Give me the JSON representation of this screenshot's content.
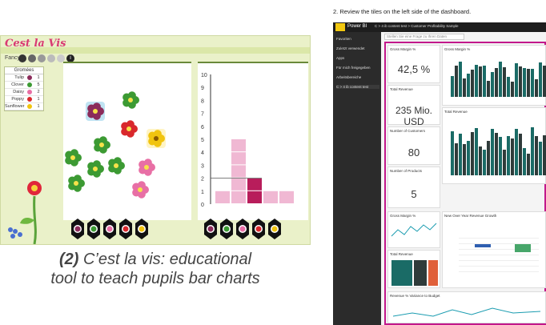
{
  "left": {
    "logo": "Cest la Vis",
    "selector_label": "Fancy",
    "circle_colors": [
      "#333333",
      "#666666",
      "#999999",
      "#bbbbbb",
      "#cccccc"
    ],
    "table_header": "Gromées",
    "flower_rows": [
      {
        "name": "Tulip",
        "color": "#8b2b5a",
        "count": "1"
      },
      {
        "name": "Clover",
        "color": "#3c9a33",
        "count": "5"
      },
      {
        "name": "Daisy",
        "color": "#e86fa5",
        "count": "2"
      },
      {
        "name": "Poppy",
        "color": "#d9282c",
        "count": "1"
      },
      {
        "name": "Sunflower",
        "color": "#f1c40f",
        "count": "1"
      }
    ],
    "y_axis_ticks": [
      "10",
      "9",
      "8",
      "7",
      "6",
      "5",
      "4",
      "3",
      "2",
      "1",
      "0"
    ],
    "caption_number": "(2)",
    "caption_rest": " C’est la vis: educational",
    "caption_line2": "tool to teach pupils bar charts"
  },
  "right": {
    "step_text": "2. Review the tiles on the left side of the dashboard.",
    "brand": "Power BI",
    "crumb": "C > 4 ib content test > Customer Profitability Sample",
    "ask_placeholder": "Stellen Sie eine Frage zu Ihren Daten",
    "nav_items": [
      "Favoriten",
      "Zuletzt verwendet",
      "Apps",
      "Für mich freigegeben",
      "Arbeitsbereiche",
      "C > 4 ib content test"
    ],
    "tiles": {
      "gross_margin_label": "Gross Margin %",
      "gross_margin_value": "42,5 %",
      "total_revenue_label": "Total Revenue",
      "total_revenue_value": "235 Mio. USD",
      "num_customers_label": "Number of Customers",
      "num_customers_value": "80",
      "num_products_label": "Number of Products",
      "num_products_value": "5",
      "chart1_label": "Gross Margin %",
      "chart2_label": "Total Revenue",
      "chart3_label": "Gross Margin %",
      "chart4_label": "New Over Year Revenue Growth",
      "chart5_label": "Total Revenue",
      "chart6_label": "Revenue % Variance to Budget"
    },
    "colors": {
      "teal": "#1a6b66",
      "dark": "#2f3b3a",
      "pink": "#c2188b",
      "green": "#47a66a"
    }
  },
  "chart_data": {
    "type": "bar",
    "title": "",
    "categories": [
      "Tulip",
      "Clover",
      "Daisy",
      "Poppy",
      "Sunflower"
    ],
    "values": [
      1,
      5,
      2,
      1,
      1
    ],
    "highlighted_value": 2,
    "ylim": [
      0,
      10
    ],
    "xlabel": "",
    "ylabel": ""
  }
}
